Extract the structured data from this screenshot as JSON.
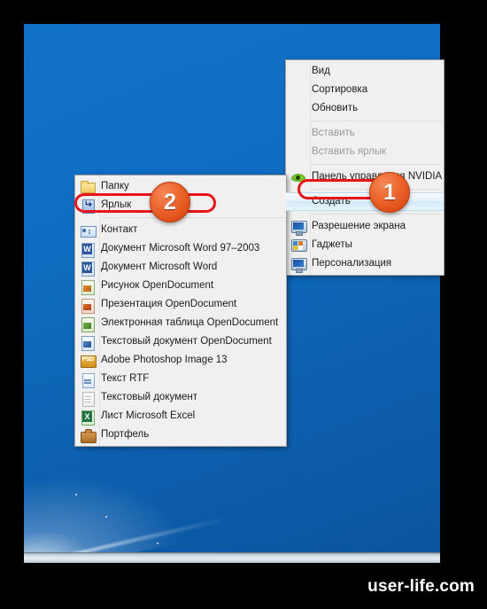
{
  "desktop": {
    "background_color": "#0f6cc0",
    "taskbar_color": "#cfd8e2"
  },
  "context_menu": {
    "items": [
      {
        "label": "Вид",
        "icon": "",
        "state": "normal"
      },
      {
        "label": "Сортировка",
        "icon": "",
        "state": "normal"
      },
      {
        "label": "Обновить",
        "icon": "",
        "state": "normal"
      },
      {
        "label": "Вставить",
        "icon": "",
        "state": "disabled"
      },
      {
        "label": "Вставить ярлык",
        "icon": "",
        "state": "disabled"
      },
      {
        "label": "Панель управления NVIDIA",
        "icon": "nvidia-icon",
        "state": "normal"
      },
      {
        "label": "Создать",
        "icon": "",
        "state": "highlighted"
      },
      {
        "label": "Разрешение экрана",
        "icon": "screen-resolution-icon",
        "state": "normal"
      },
      {
        "label": "Гаджеты",
        "icon": "gadgets-icon",
        "state": "normal"
      },
      {
        "label": "Персонализация",
        "icon": "personalization-icon",
        "state": "normal"
      }
    ]
  },
  "submenu": {
    "items": [
      {
        "label": "Папку",
        "icon": "folder-icon"
      },
      {
        "label": "Ярлык",
        "icon": "shortcut-icon"
      },
      {
        "label": "Контакт",
        "icon": "contact-icon"
      },
      {
        "label": "Документ Microsoft Word 97–2003",
        "icon": "word-document-icon"
      },
      {
        "label": "Документ Microsoft Word",
        "icon": "word-document-icon"
      },
      {
        "label": "Рисунок OpenDocument",
        "icon": "opendocument-drawing-icon"
      },
      {
        "label": "Презентация OpenDocument",
        "icon": "opendocument-presentation-icon"
      },
      {
        "label": "Электронная таблица OpenDocument",
        "icon": "opendocument-spreadsheet-icon"
      },
      {
        "label": "Текстовый документ OpenDocument",
        "icon": "opendocument-text-icon"
      },
      {
        "label": "Adobe Photoshop Image 13",
        "icon": "photoshop-psd-icon"
      },
      {
        "label": "Текст RTF",
        "icon": "rtf-document-icon"
      },
      {
        "label": "Текстовый документ",
        "icon": "text-document-icon"
      },
      {
        "label": "Лист Microsoft Excel",
        "icon": "excel-sheet-icon"
      },
      {
        "label": "Портфель",
        "icon": "briefcase-icon"
      }
    ]
  },
  "annotations": {
    "badge_one": "1",
    "badge_two": "2",
    "highlight_color": "#e8151b",
    "badge_color": "#e2521c"
  },
  "watermark": {
    "text": "user-life.com"
  }
}
